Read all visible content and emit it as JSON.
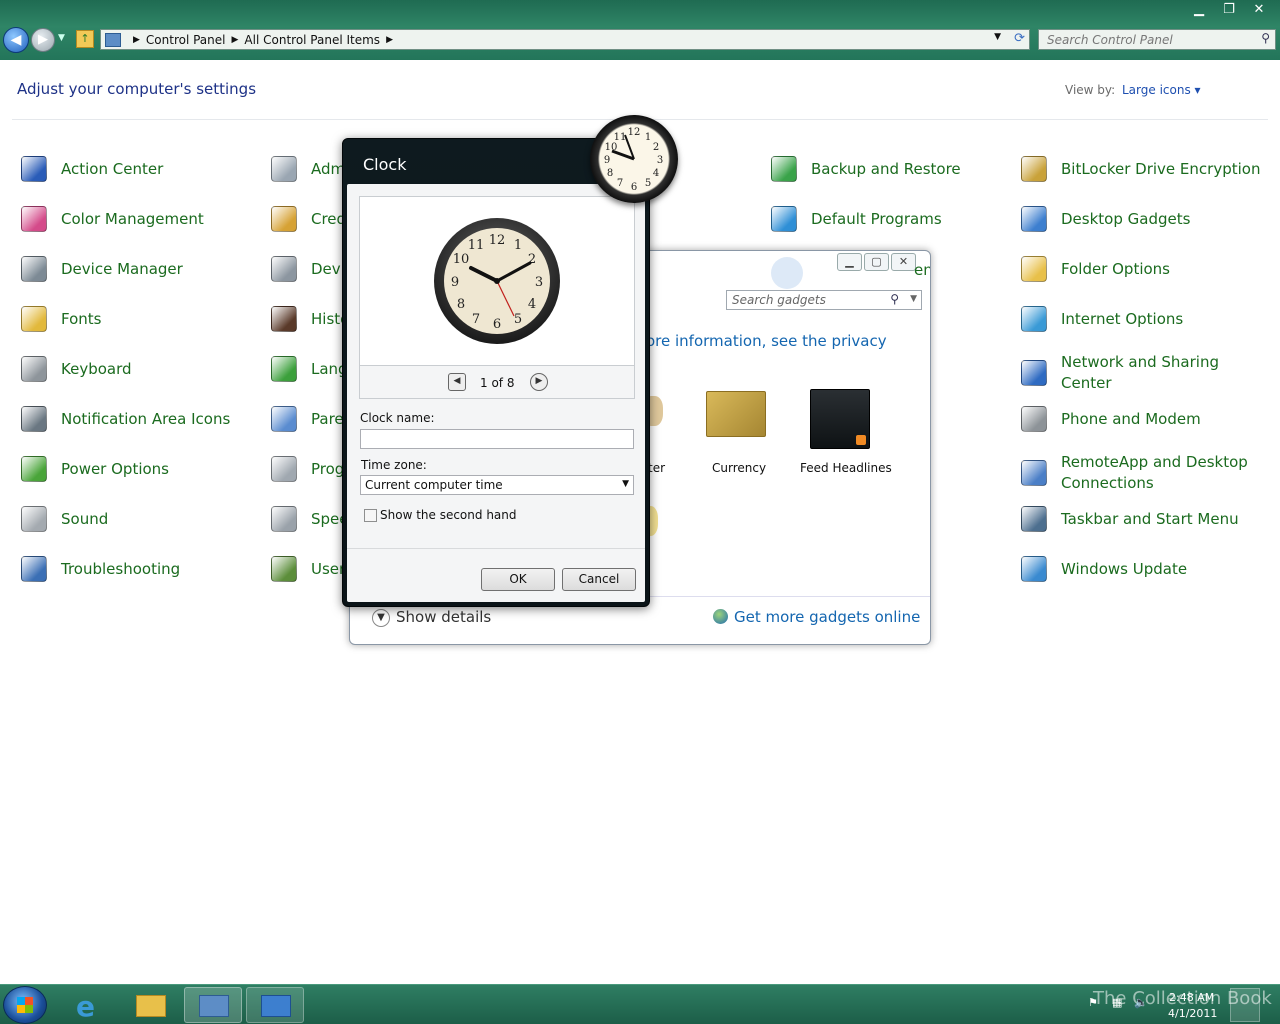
{
  "window": {
    "minimize": "▁",
    "maximize": "❐",
    "close": "✕"
  },
  "address": {
    "crumbs": [
      "Control Panel",
      "All Control Panel Items"
    ]
  },
  "search": {
    "placeholder": "Search Control Panel"
  },
  "heading": "Adjust your computer's settings",
  "viewby": {
    "label": "View by:",
    "value": "Large icons ▾"
  },
  "items": [
    {
      "label": "Action Center",
      "icon": "flag-icon",
      "color": "#2a5cb8"
    },
    {
      "label": "Adm",
      "icon": "admin-tools-icon",
      "color": "#9aa6b2"
    },
    {
      "label": "Backup and Restore",
      "icon": "backup-icon",
      "color": "#3aa34a"
    },
    {
      "label": "BitLocker Drive Encryption",
      "icon": "lock-icon",
      "color": "#c9a23a"
    },
    {
      "label": "Color Management",
      "icon": "color-icon",
      "color": "#d44b8a"
    },
    {
      "label": "Cred",
      "icon": "credential-icon",
      "color": "#d6a235"
    },
    {
      "label": "Default Programs",
      "icon": "default-programs-icon",
      "color": "#2f8fd6"
    },
    {
      "label": "Desktop Gadgets",
      "icon": "gadgets-icon",
      "color": "#3d7fcf"
    },
    {
      "label": "Device Manager",
      "icon": "device-manager-icon",
      "color": "#7d8a95"
    },
    {
      "label": "Devi",
      "icon": "printer-icon",
      "color": "#8c96a0"
    },
    {
      "label": "Folder Options",
      "icon": "folder-icon",
      "color": "#e8c04a"
    },
    {
      "label": "Fonts",
      "icon": "fonts-icon",
      "color": "#e2b93c"
    },
    {
      "label": "Histo",
      "icon": "history-icon",
      "color": "#5a3a2a"
    },
    {
      "label": "Internet Options",
      "icon": "internet-icon",
      "color": "#3a9ad6"
    },
    {
      "label": "Keyboard",
      "icon": "keyboard-icon",
      "color": "#8e959b"
    },
    {
      "label": "Lang",
      "icon": "globe-icon",
      "color": "#3ca03c"
    },
    {
      "label": "Network and Sharing Center",
      "icon": "network-icon",
      "color": "#2f6bc2"
    },
    {
      "label": "Notification Area Icons",
      "icon": "notification-icon",
      "color": "#6a7782"
    },
    {
      "label": "Pare",
      "icon": "parental-icon",
      "color": "#5a8cd0"
    },
    {
      "label": "Phone and Modem",
      "icon": "phone-icon",
      "color": "#8d9398"
    },
    {
      "label": "Power Options",
      "icon": "power-icon",
      "color": "#4aa53a"
    },
    {
      "label": "Prog",
      "icon": "programs-icon",
      "color": "#a0a8b0"
    },
    {
      "label": "RemoteApp and Desktop Connections",
      "icon": "remote-icon",
      "color": "#4b7fc7"
    },
    {
      "label": "Sound",
      "icon": "speaker-icon",
      "color": "#a4aab0"
    },
    {
      "label": "Spee",
      "icon": "microphone-icon",
      "color": "#9aa2aa"
    },
    {
      "label": "Taskbar and Start Menu",
      "icon": "taskbar-icon",
      "color": "#4d6f8f"
    },
    {
      "label": "Troubleshooting",
      "icon": "troubleshoot-icon",
      "color": "#3b6fb5"
    },
    {
      "label": "User",
      "icon": "users-icon",
      "color": "#5c8e3b"
    },
    {
      "label": "Windows Update",
      "icon": "update-icon",
      "color": "#3a8ad0"
    }
  ],
  "gallery": {
    "search_placeholder": "Search gadgets",
    "privacy_text": "ore information, see the privacy",
    "ghost_text_1": "enter",
    "gadgets": [
      {
        "label": "ter"
      },
      {
        "label": "Currency"
      },
      {
        "label": "Feed Headlines"
      }
    ],
    "show_details": "Show details",
    "get_more": "Get more gadgets online"
  },
  "dialog": {
    "title": "Clock",
    "pager_prev": "◀",
    "pager_next": "▶",
    "pager_count": "1 of 8",
    "clock_name_label": "Clock name:",
    "clock_name_value": "",
    "timezone_label": "Time zone:",
    "timezone_value": "Current computer time",
    "second_hand_label": "Show the second hand",
    "ok": "OK",
    "cancel": "Cancel"
  },
  "taskbar": {
    "time": "2:48 AM",
    "date": "4/1/2011",
    "watermark": "The Collection Book"
  }
}
